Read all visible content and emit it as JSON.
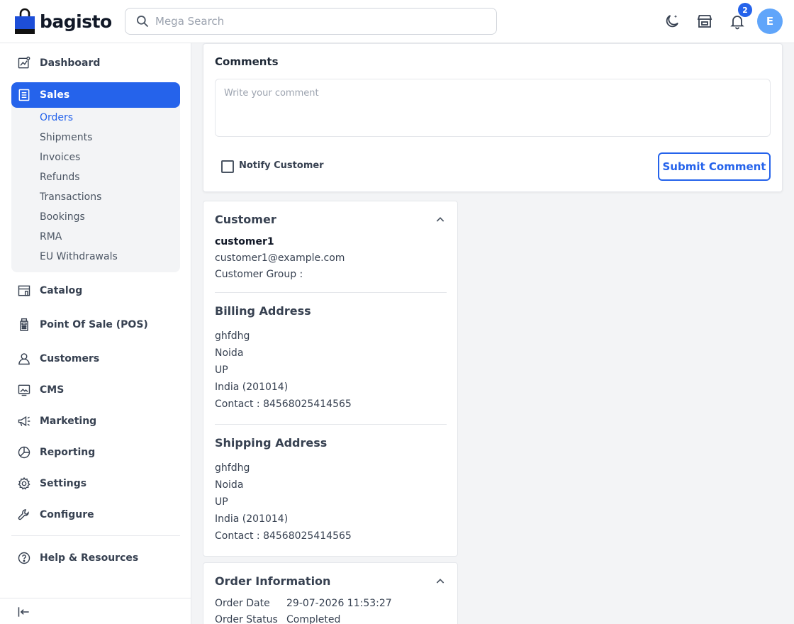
{
  "header": {
    "logo_text": "bagisto",
    "search_placeholder": "Mega Search",
    "notification_count": "2",
    "avatar_initial": "E"
  },
  "sidebar": {
    "items": [
      {
        "label": "Dashboard",
        "icon": "dashboard-icon"
      },
      {
        "label": "Sales",
        "icon": "sales-icon",
        "active": true
      },
      {
        "label": "Catalog",
        "icon": "catalog-icon"
      },
      {
        "label": "Point Of Sale (POS)",
        "icon": "pos-icon"
      },
      {
        "label": "Customers",
        "icon": "customers-icon"
      },
      {
        "label": "CMS",
        "icon": "cms-icon"
      },
      {
        "label": "Marketing",
        "icon": "marketing-icon"
      },
      {
        "label": "Reporting",
        "icon": "reporting-icon"
      },
      {
        "label": "Settings",
        "icon": "settings-icon"
      },
      {
        "label": "Configure",
        "icon": "configure-icon"
      },
      {
        "label": "Help & Resources",
        "icon": "help-icon"
      }
    ],
    "sales_sub": [
      "Orders",
      "Shipments",
      "Invoices",
      "Refunds",
      "Transactions",
      "Bookings",
      "RMA",
      "EU Withdrawals"
    ],
    "active_sub": "Orders"
  },
  "comments": {
    "title": "Comments",
    "placeholder": "Write your comment",
    "notify_label": "Notify Customer",
    "submit_label": "Submit Comment"
  },
  "customer": {
    "title": "Customer",
    "name": "customer1",
    "email": "customer1@example.com",
    "group": "Customer Group :"
  },
  "billing": {
    "title": "Billing Address",
    "lines": [
      "ghfdhg",
      "Noida",
      "UP",
      "India (201014)",
      "Contact : 84568025414565"
    ]
  },
  "shipping": {
    "title": "Shipping Address",
    "lines": [
      "ghfdhg",
      "Noida",
      "UP",
      "India (201014)",
      "Contact : 84568025414565"
    ]
  },
  "order_info": {
    "title": "Order Information",
    "order_date_label": "Order Date",
    "order_date": "29-07-2026 11:53:27",
    "order_status_label": "Order Status",
    "order_status": "Completed"
  },
  "colors": {
    "accent": "#2563eb",
    "avatar": "#60a5fa"
  }
}
